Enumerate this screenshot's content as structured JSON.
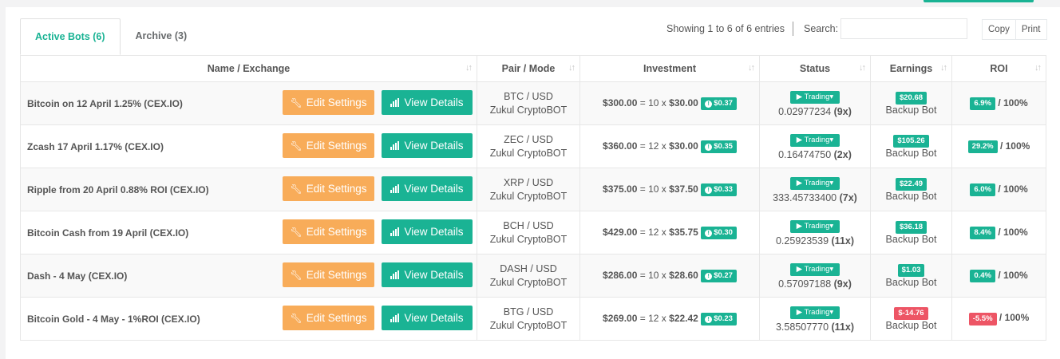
{
  "tabs": [
    {
      "label": "Active Bots (6)",
      "active": true
    },
    {
      "label": "Archive (3)",
      "active": false
    }
  ],
  "table_info": "Showing 1 to 6 of 6 entries",
  "search": {
    "label": "Search:",
    "value": ""
  },
  "buttons": {
    "copy": "Copy",
    "print": "Print"
  },
  "columns": [
    "Name / Exchange",
    "Pair / Mode",
    "Investment",
    "Status",
    "Earnings",
    "ROI"
  ],
  "row_actions": {
    "edit": "Edit Settings",
    "view": "View Details"
  },
  "rows": [
    {
      "name": "Bitcoin on 12 April 1.25% (CEX.IO)",
      "pair": "BTC / USD",
      "mode": "Zukul CryptoBOT",
      "invest_total": "$300.00",
      "invest_mult": "= 10 x",
      "invest_unit": "$30.00",
      "invest_fee": "$0.37",
      "status_btn": "Trading",
      "status_amount": "0.02977234",
      "status_count": "(9x)",
      "earnings": "$20.68",
      "earnings_negative": false,
      "earnings_sub": "Backup Bot",
      "roi": "6.9%",
      "roi_negative": false,
      "roi_target": "/ 100%"
    },
    {
      "name": "Zcash 17 April 1.17% (CEX.IO)",
      "pair": "ZEC / USD",
      "mode": "Zukul CryptoBOT",
      "invest_total": "$360.00",
      "invest_mult": "= 12 x",
      "invest_unit": "$30.00",
      "invest_fee": "$0.35",
      "status_btn": "Trading",
      "status_amount": "0.16474750",
      "status_count": "(2x)",
      "earnings": "$105.26",
      "earnings_negative": false,
      "earnings_sub": "Backup Bot",
      "roi": "29.2%",
      "roi_negative": false,
      "roi_target": "/ 100%"
    },
    {
      "name": "Ripple from 20 April 0.88% ROI (CEX.IO)",
      "pair": "XRP / USD",
      "mode": "Zukul CryptoBOT",
      "invest_total": "$375.00",
      "invest_mult": "= 10 x",
      "invest_unit": "$37.50",
      "invest_fee": "$0.33",
      "status_btn": "Trading",
      "status_amount": "333.45733400",
      "status_count": "(7x)",
      "earnings": "$22.49",
      "earnings_negative": false,
      "earnings_sub": "Backup Bot",
      "roi": "6.0%",
      "roi_negative": false,
      "roi_target": "/ 100%"
    },
    {
      "name": "Bitcoin Cash from 19 April (CEX.IO)",
      "pair": "BCH / USD",
      "mode": "Zukul CryptoBOT",
      "invest_total": "$429.00",
      "invest_mult": "= 12 x",
      "invest_unit": "$35.75",
      "invest_fee": "$0.30",
      "status_btn": "Trading",
      "status_amount": "0.25923539",
      "status_count": "(11x)",
      "earnings": "$36.18",
      "earnings_negative": false,
      "earnings_sub": "Backup Bot",
      "roi": "8.4%",
      "roi_negative": false,
      "roi_target": "/ 100%"
    },
    {
      "name": "Dash - 4 May (CEX.IO)",
      "pair": "DASH / USD",
      "mode": "Zukul CryptoBOT",
      "invest_total": "$286.00",
      "invest_mult": "= 10 x",
      "invest_unit": "$28.60",
      "invest_fee": "$0.27",
      "status_btn": "Trading",
      "status_amount": "0.57097188",
      "status_count": "(9x)",
      "earnings": "$1.03",
      "earnings_negative": false,
      "earnings_sub": "Backup Bot",
      "roi": "0.4%",
      "roi_negative": false,
      "roi_target": "/ 100%"
    },
    {
      "name": "Bitcoin Gold - 4 May - 1%ROI (CEX.IO)",
      "pair": "BTG / USD",
      "mode": "Zukul CryptoBOT",
      "invest_total": "$269.00",
      "invest_mult": "= 12 x",
      "invest_unit": "$22.42",
      "invest_fee": "$0.23",
      "status_btn": "Trading",
      "status_amount": "3.58507770",
      "status_count": "(11x)",
      "earnings": "$-14.76",
      "earnings_negative": true,
      "earnings_sub": "Backup Bot",
      "roi": "-5.5%",
      "roi_negative": true,
      "roi_target": "/ 100%"
    }
  ],
  "colors": {
    "accent": "#1ab394",
    "warning": "#f8ac59",
    "danger": "#ed5565"
  }
}
